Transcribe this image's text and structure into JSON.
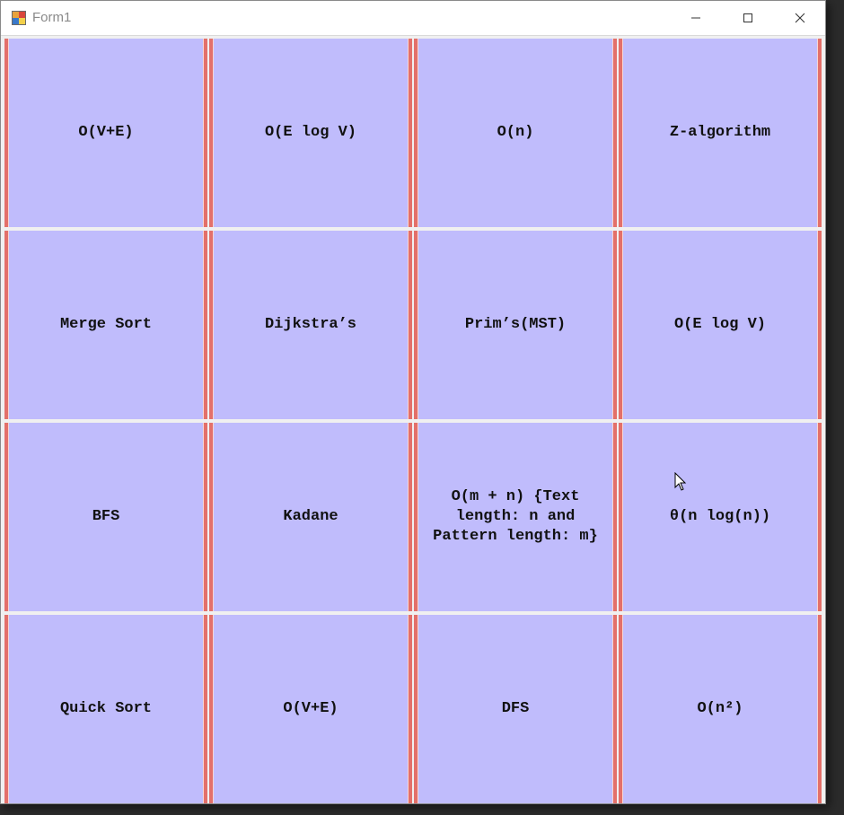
{
  "window": {
    "title": "Form1"
  },
  "icons": {
    "app": "form-app-icon",
    "minimize": "minimize-icon",
    "maximize": "maximize-icon",
    "close": "close-icon",
    "cursor": "mouse-pointer-icon"
  },
  "colors": {
    "cell_background": "#c0bcfc",
    "cell_border": "#e3706a",
    "title_text": "#8a8a8a"
  },
  "grid": {
    "rows": [
      [
        "O(V+E)",
        "O(E log V)",
        "O(n)",
        "Z-algorithm"
      ],
      [
        "Merge Sort",
        "Dijkstra’s",
        "Prim’s(MST)",
        "O(E log V)"
      ],
      [
        "BFS",
        "Kadane",
        "O(m + n) {Text length: n and Pattern length: m}",
        "θ(n log(n))"
      ],
      [
        "Quick Sort",
        "O(V+E)",
        "DFS",
        "O(n²)"
      ]
    ]
  }
}
